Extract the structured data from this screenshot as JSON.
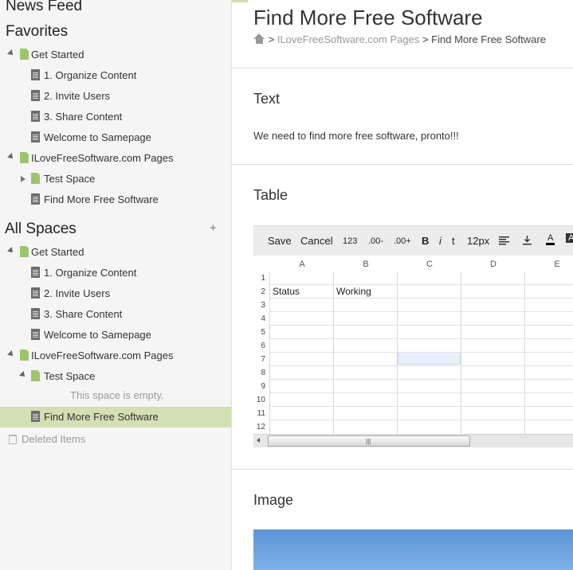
{
  "sidebar": {
    "news_feed": "News Feed",
    "favorites_heading": "Favorites",
    "favorites": [
      {
        "label": "Get Started"
      },
      {
        "label": "1. Organize Content"
      },
      {
        "label": "2. Invite Users"
      },
      {
        "label": "3. Share Content"
      },
      {
        "label": "Welcome to Samepage"
      },
      {
        "label": "ILoveFreeSoftware.com Pages"
      },
      {
        "label": "Test Space"
      },
      {
        "label": "Find More Free Software"
      }
    ],
    "all_spaces_heading": "All Spaces",
    "add_space": "+",
    "all_spaces": [
      {
        "label": "Get Started"
      },
      {
        "label": "1. Organize Content"
      },
      {
        "label": "2. Invite Users"
      },
      {
        "label": "3. Share Content"
      },
      {
        "label": "Welcome to Samepage"
      },
      {
        "label": "ILoveFreeSoftware.com Pages"
      },
      {
        "label": "Test Space"
      },
      {
        "label": "Find More Free Software"
      }
    ],
    "empty_space_note": "This space is empty.",
    "deleted_items": "Deleted Items"
  },
  "page": {
    "title": "Find More Free Software",
    "breadcrumb": {
      "sep1": ">",
      "parent": "ILoveFreeSoftware.com Pages",
      "sep2": ">",
      "current": "Find More Free Software"
    }
  },
  "text_section": {
    "title": "Text",
    "body": "We need to find more free software, pronto!!!"
  },
  "table_section": {
    "title": "Table",
    "toolbar": {
      "save": "Save",
      "cancel": "Cancel",
      "number_format": "123",
      "decrease_decimal": ".00-",
      "increase_decimal": ".00+",
      "bold": "B",
      "italic": "i",
      "font_size_icon": "t",
      "font_size": "12px",
      "align_icon": "align-left-icon",
      "valign_icon": "align-bottom-icon",
      "text_color": "A",
      "fill_color": "A"
    },
    "columns": [
      "A",
      "B",
      "C",
      "D",
      "E"
    ],
    "rows": [
      "1",
      "2",
      "3",
      "4",
      "5",
      "6",
      "7",
      "8",
      "9",
      "10",
      "11",
      "12"
    ],
    "cells": {
      "A2": "Status",
      "B2": "Working"
    },
    "scroll_grip": "|||"
  },
  "image_section": {
    "title": "Image"
  },
  "colors": {
    "selected_row": "#d3dfb4",
    "space_icon": "#9dc66b",
    "active_cell": "#e8f0fb"
  }
}
